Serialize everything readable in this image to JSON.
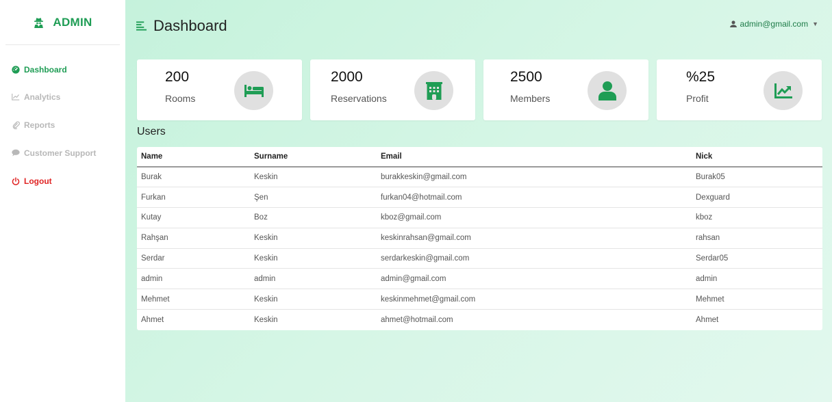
{
  "brand": {
    "label": "ADMIN"
  },
  "sidebar": {
    "items": [
      {
        "label": "Dashboard",
        "icon": "tachometer-icon"
      },
      {
        "label": "Analytics",
        "icon": "area-chart-icon"
      },
      {
        "label": "Reports",
        "icon": "paperclip-icon"
      },
      {
        "label": "Customer Support",
        "icon": "comment-icon"
      },
      {
        "label": "Logout",
        "icon": "power-icon"
      }
    ]
  },
  "header": {
    "title": "Dashboard",
    "user_email": "admin@gmail.com"
  },
  "cards": [
    {
      "value": "200",
      "label": "Rooms",
      "icon": "bed-icon"
    },
    {
      "value": "2000",
      "label": "Reservations",
      "icon": "building-icon"
    },
    {
      "value": "2500",
      "label": "Members",
      "icon": "user-icon"
    },
    {
      "value": "%25",
      "label": "Profit",
      "icon": "chart-line-icon"
    }
  ],
  "users": {
    "title": "Users",
    "columns": [
      "Name",
      "Surname",
      "Email",
      "Nick"
    ],
    "rows": [
      [
        "Burak",
        "Keskin",
        "burakkeskin@gmail.com",
        "Burak05"
      ],
      [
        "Furkan",
        "Şen",
        "furkan04@hotmail.com",
        "Dexguard"
      ],
      [
        "Kutay",
        "Boz",
        "kboz@gmail.com",
        "kboz"
      ],
      [
        "Rahşan",
        "Keskin",
        "keskinrahsan@gmail.com",
        "rahsan"
      ],
      [
        "Serdar",
        "Keskin",
        "serdarkeskin@gmail.com",
        "Serdar05"
      ],
      [
        "admin",
        "admin",
        "admin@gmail.com",
        "admin"
      ],
      [
        "Mehmet",
        "Keskin",
        "keskinmehmet@gmail.com",
        "Mehmet"
      ],
      [
        "Ahmet",
        "Keskin",
        "ahmet@hotmail.com",
        "Ahmet"
      ]
    ]
  },
  "colors": {
    "accent": "#1f9d55",
    "logout": "#e02424",
    "background_gradient_start": "#c5f2dc"
  }
}
